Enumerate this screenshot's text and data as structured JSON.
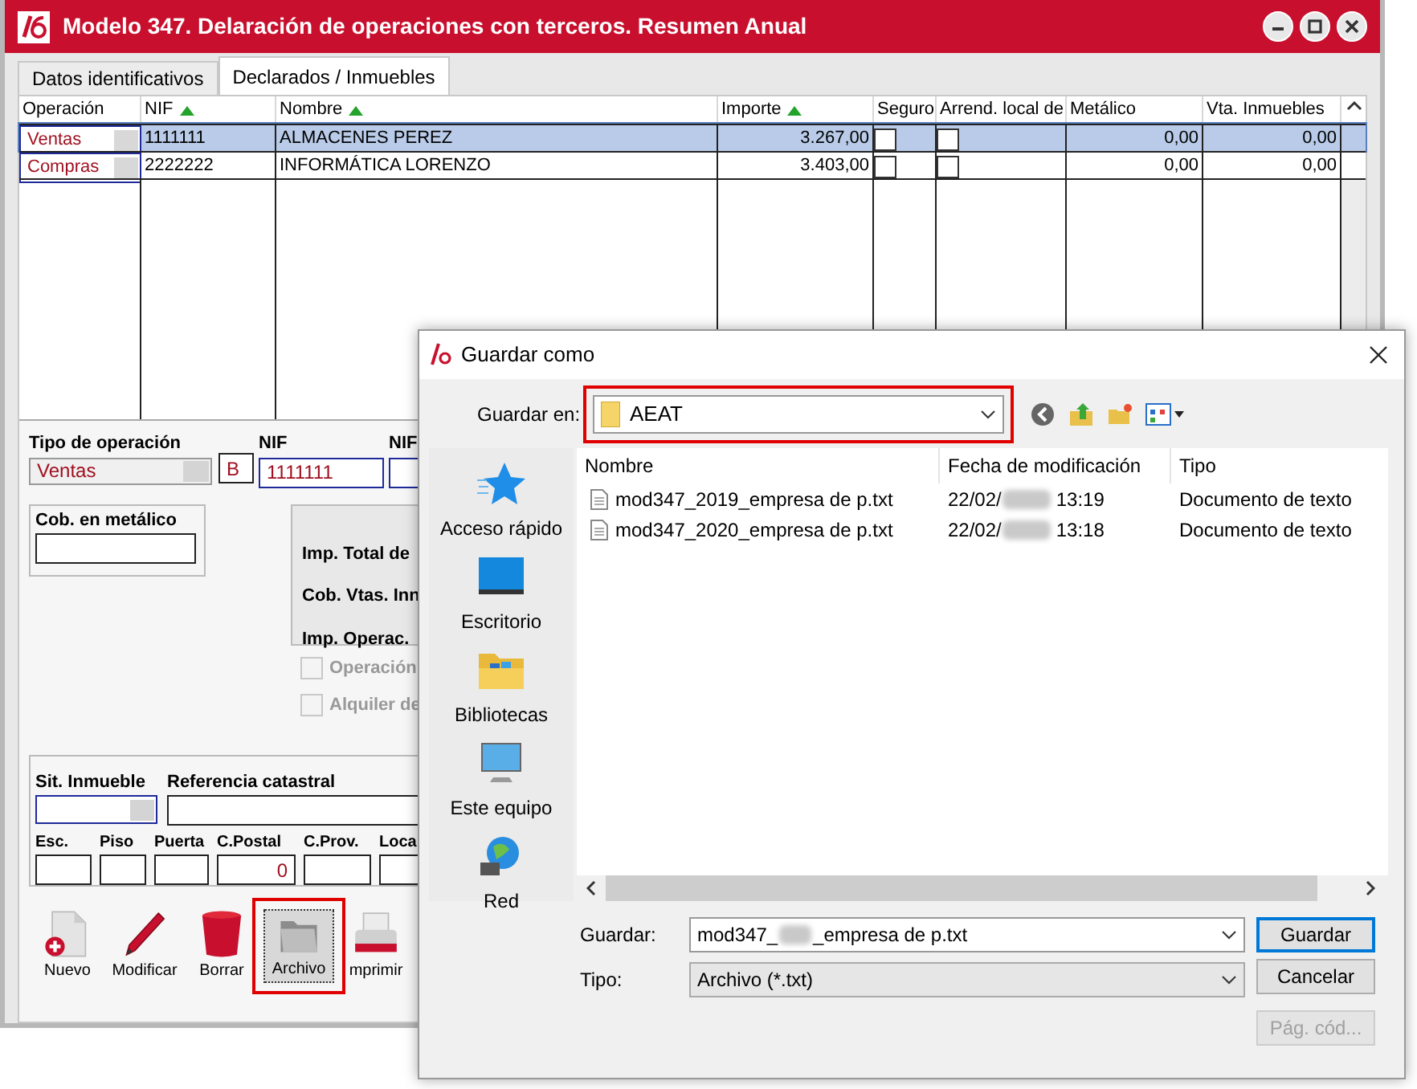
{
  "main_window": {
    "title": "Modelo 347. Delaración de operaciones con terceros. Resumen Anual",
    "tabs": [
      {
        "label": "Datos identificativos",
        "selected": false
      },
      {
        "label": "Declarados / Inmuebles",
        "selected": true
      }
    ],
    "table": {
      "columns": [
        {
          "label": "Operación",
          "sorted": false
        },
        {
          "label": "NIF",
          "sorted": true
        },
        {
          "label": "Nombre",
          "sorted": true
        },
        {
          "label": "Importe",
          "sorted": true
        },
        {
          "label": "Seguro",
          "sorted": false
        },
        {
          "label": "Arrend. local de",
          "sorted": false
        },
        {
          "label": "Metálico",
          "sorted": false
        },
        {
          "label": "Vta. Inmuebles",
          "sorted": false
        }
      ],
      "rows": [
        {
          "operacion": "Ventas",
          "nif": "1111111",
          "nombre": "ALMACENES PEREZ",
          "importe": "3.267,00",
          "seguro": false,
          "arrend": false,
          "metalico": "0,00",
          "vta_inmuebles": "0,00",
          "selected": true
        },
        {
          "operacion": "Compras",
          "nif": "2222222",
          "nombre": "INFORMÁTICA LORENZO",
          "importe": "3.403,00",
          "seguro": false,
          "arrend": false,
          "metalico": "0,00",
          "vta_inmuebles": "0,00",
          "selected": false
        }
      ]
    },
    "form": {
      "tipo_label": "Tipo de operación",
      "tipo_value": "Ventas",
      "clave": "B",
      "nif_label": "NIF",
      "nif_value": "1111111",
      "nif2_label": "NIF",
      "cob_label": "Cob. en metálico",
      "summary_labels": [
        "Imp. Total de",
        "Cob. Vtas. Inn",
        "Imp. Operac."
      ],
      "checkboxes": [
        {
          "label": "Operación",
          "checked": false,
          "disabled": true
        },
        {
          "label": "Alquiler de",
          "checked": false,
          "disabled": true
        }
      ],
      "sit_label": "Sit. Inmueble",
      "ref_label": "Referencia catastral",
      "address_fields": [
        {
          "label": "Esc."
        },
        {
          "label": "Piso"
        },
        {
          "label": "Puerta"
        },
        {
          "label": "C.Postal",
          "value": "0"
        },
        {
          "label": "C.Prov."
        },
        {
          "label": "Loca"
        }
      ]
    },
    "toolbar": [
      {
        "label": "Nuevo",
        "kind": "new",
        "highlighted": false
      },
      {
        "label": "Modificar",
        "kind": "edit",
        "highlighted": false
      },
      {
        "label": "Borrar",
        "kind": "delete",
        "highlighted": false
      },
      {
        "label": "Archivo",
        "kind": "file",
        "highlighted": true
      },
      {
        "label": "mprimir",
        "kind": "print",
        "highlighted": false
      }
    ]
  },
  "dialog": {
    "title": "Guardar como",
    "save_in_label": "Guardar en:",
    "save_in_value": "AEAT",
    "save_in_highlighted": true,
    "places": [
      {
        "label": "Acceso rápido",
        "kind": "star"
      },
      {
        "label": "Escritorio",
        "kind": "desktop"
      },
      {
        "label": "Bibliotecas",
        "kind": "library"
      },
      {
        "label": "Este equipo",
        "kind": "computer"
      },
      {
        "label": "Red",
        "kind": "network"
      }
    ],
    "columns": [
      "Nombre",
      "Fecha de modificación",
      "Tipo"
    ],
    "files": [
      {
        "name": "mod347_2019_empresa de p.txt",
        "date": "22/02/",
        "time": "13:19",
        "type": "Documento de texto"
      },
      {
        "name": "mod347_2020_empresa de p.txt",
        "date": "22/02/",
        "time": "13:18",
        "type": "Documento de texto"
      }
    ],
    "filename_label": "Guardar:",
    "filename_start": "mod347_",
    "filename_end": "_empresa de p.txt",
    "type_label": "Tipo:",
    "type_value": "Archivo (*.txt)",
    "buttons": [
      {
        "label": "Guardar",
        "default": true,
        "disabled": false
      },
      {
        "label": "Cancelar",
        "default": false,
        "disabled": false
      },
      {
        "label": "Pág. cód...",
        "default": false,
        "disabled": true
      }
    ]
  }
}
